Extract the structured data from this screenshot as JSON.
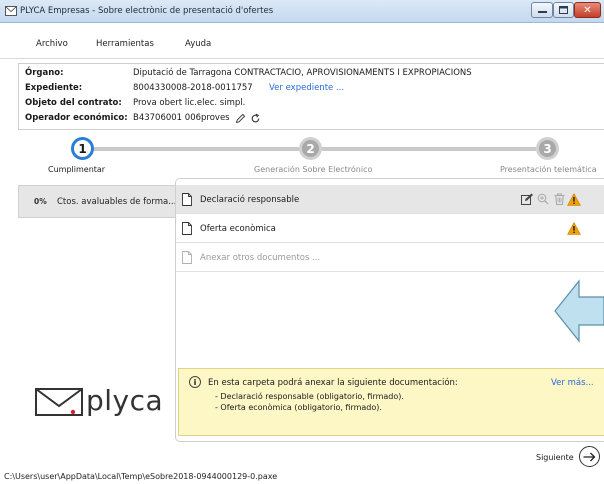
{
  "window": {
    "title": "PLYCA Empresas - Sobre electrònic de presentació d'ofertes",
    "controls": {
      "minimize": "—",
      "maximize": "▢",
      "close": "✕"
    }
  },
  "menu": [
    "Archivo",
    "Herramientas",
    "Ayuda"
  ],
  "info": {
    "organo_label": "Órgano:",
    "organo_value": "Diputació de Tarragona  CONTRACTACIO, APROVISIONAMENTS I EXPROPIACIONS",
    "expediente_label": "Expediente:",
    "expediente_value": "8004330008-2018-0011757",
    "expediente_link": "Ver expediente ...",
    "objeto_label": "Objeto del contrato:",
    "objeto_value": "Prova obert lic.elec. simpl.",
    "operador_label": "Operador económico:",
    "operador_value": "B43706001 006proves"
  },
  "steps": [
    {
      "number": "1",
      "label": "Cumplimentar",
      "state": "active"
    },
    {
      "number": "2",
      "label": "Generación Sobre Electrónico",
      "state": "pending"
    },
    {
      "number": "3",
      "label": "Presentación telemática",
      "state": "pending"
    }
  ],
  "folder": {
    "percent": "0%",
    "label": "Ctos. avaluables de forma..."
  },
  "logo": {
    "text": "plyca"
  },
  "documents": [
    {
      "label": "Declaració responsable",
      "selected": true,
      "warning": true
    },
    {
      "label": "Oferta econòmica",
      "selected": false,
      "warning": true
    },
    {
      "label": "Anexar otros documentos ...",
      "selected": false,
      "warning": false
    }
  ],
  "note": {
    "title": "En esta carpeta podrá anexar la siguiente documentación:",
    "more": "Ver más...",
    "lines": [
      "- Declaració responsable (obligatorio, firmado).",
      "- Oferta econòmica (obligatorio, firmado)."
    ]
  },
  "next_label": "Siguiente",
  "status_path": "C:\\Users\\user\\AppData\\Local\\Temp\\eSobre2018-0944000129-0.paxe",
  "colors": {
    "accent": "#2a7fd4",
    "warning": "#f0a000",
    "link": "#2a6ad6",
    "note_bg": "#fdf7c6",
    "arrow_fill": "#bfe0ee"
  }
}
